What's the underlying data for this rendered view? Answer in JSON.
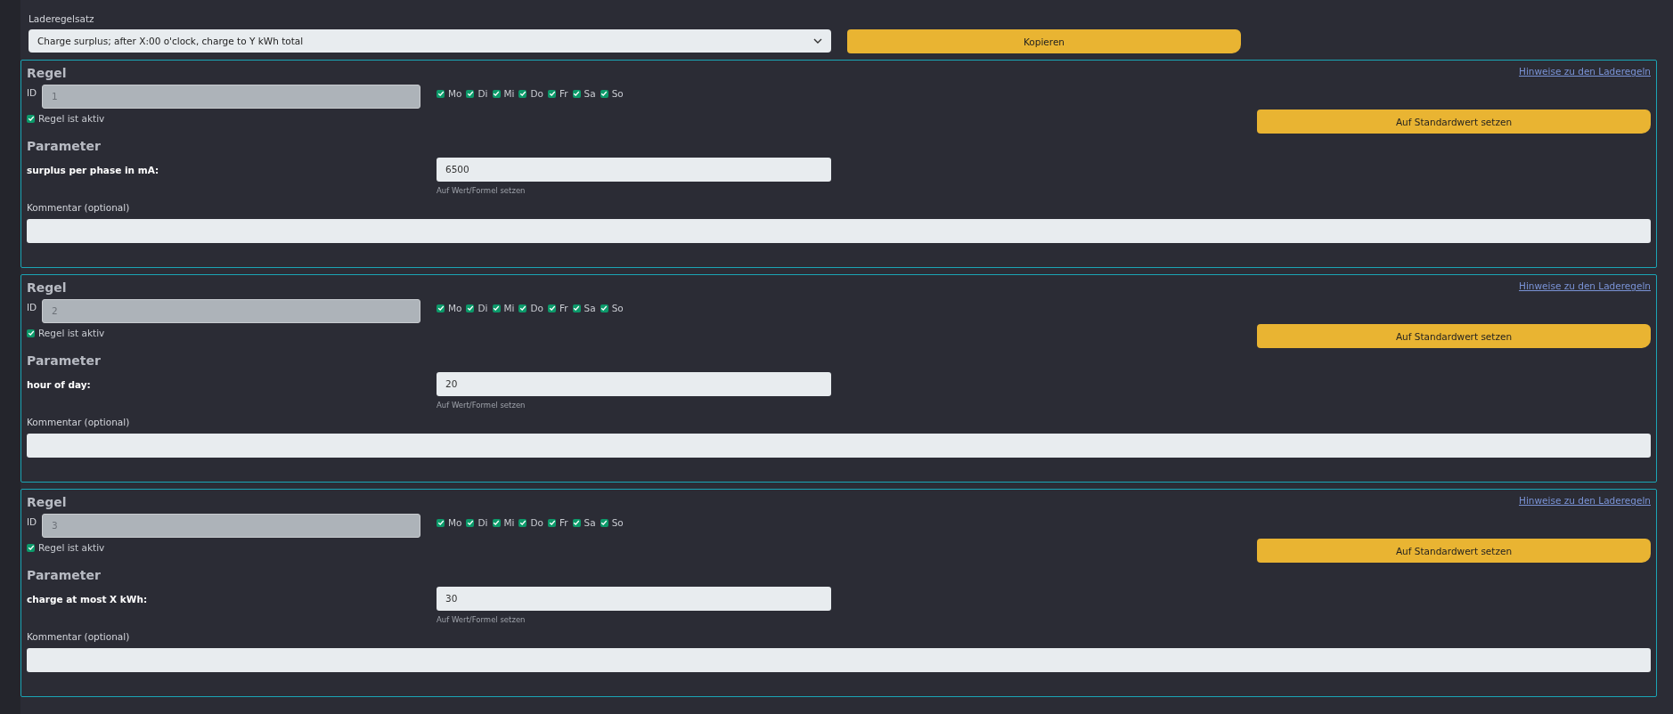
{
  "rule_set": {
    "label": "Laderegelsatz",
    "value": "Charge surplus; after X:00 o'clock, charge to Y kWh total",
    "copy_button": "Kopieren"
  },
  "rules": [
    {
      "title": "Regel",
      "id_label": "ID",
      "id_value": "1",
      "days": [
        {
          "label": "Mo",
          "checked": true
        },
        {
          "label": "Di",
          "checked": true
        },
        {
          "label": "Mi",
          "checked": true
        },
        {
          "label": "Do",
          "checked": true
        },
        {
          "label": "Fr",
          "checked": true
        },
        {
          "label": "Sa",
          "checked": true
        },
        {
          "label": "So",
          "checked": true
        }
      ],
      "help_link": "Hinweise zu den Laderegeln",
      "default_button": "Auf Standardwert setzen",
      "active": {
        "label": "Regel ist aktiv",
        "checked": true
      },
      "parameter_heading": "Parameter",
      "parameter": {
        "label": "surplus per phase in mA:",
        "value": "6500",
        "hint": "Auf Wert/Formel setzen"
      },
      "comment": {
        "label": "Kommentar (optional)"
      }
    },
    {
      "title": "Regel",
      "id_label": "ID",
      "id_value": "2",
      "days": [
        {
          "label": "Mo",
          "checked": true
        },
        {
          "label": "Di",
          "checked": true
        },
        {
          "label": "Mi",
          "checked": true
        },
        {
          "label": "Do",
          "checked": true
        },
        {
          "label": "Fr",
          "checked": true
        },
        {
          "label": "Sa",
          "checked": true
        },
        {
          "label": "So",
          "checked": true
        }
      ],
      "help_link": "Hinweise zu den Laderegeln",
      "default_button": "Auf Standardwert setzen",
      "active": {
        "label": "Regel ist aktiv",
        "checked": true
      },
      "parameter_heading": "Parameter",
      "parameter": {
        "label": "hour of day:",
        "value": "20",
        "hint": "Auf Wert/Formel setzen"
      },
      "comment": {
        "label": "Kommentar (optional)"
      }
    },
    {
      "title": "Regel",
      "id_label": "ID",
      "id_value": "3",
      "days": [
        {
          "label": "Mo",
          "checked": true
        },
        {
          "label": "Di",
          "checked": true
        },
        {
          "label": "Mi",
          "checked": true
        },
        {
          "label": "Do",
          "checked": true
        },
        {
          "label": "Fr",
          "checked": true
        },
        {
          "label": "Sa",
          "checked": true
        },
        {
          "label": "So",
          "checked": true
        }
      ],
      "help_link": "Hinweise zu den Laderegeln",
      "default_button": "Auf Standardwert setzen",
      "active": {
        "label": "Regel ist aktiv",
        "checked": true
      },
      "parameter_heading": "Parameter",
      "parameter": {
        "label": "charge at most X kWh:",
        "value": "30",
        "hint": "Auf Wert/Formel setzen"
      },
      "comment": {
        "label": "Kommentar (optional)"
      }
    }
  ]
}
